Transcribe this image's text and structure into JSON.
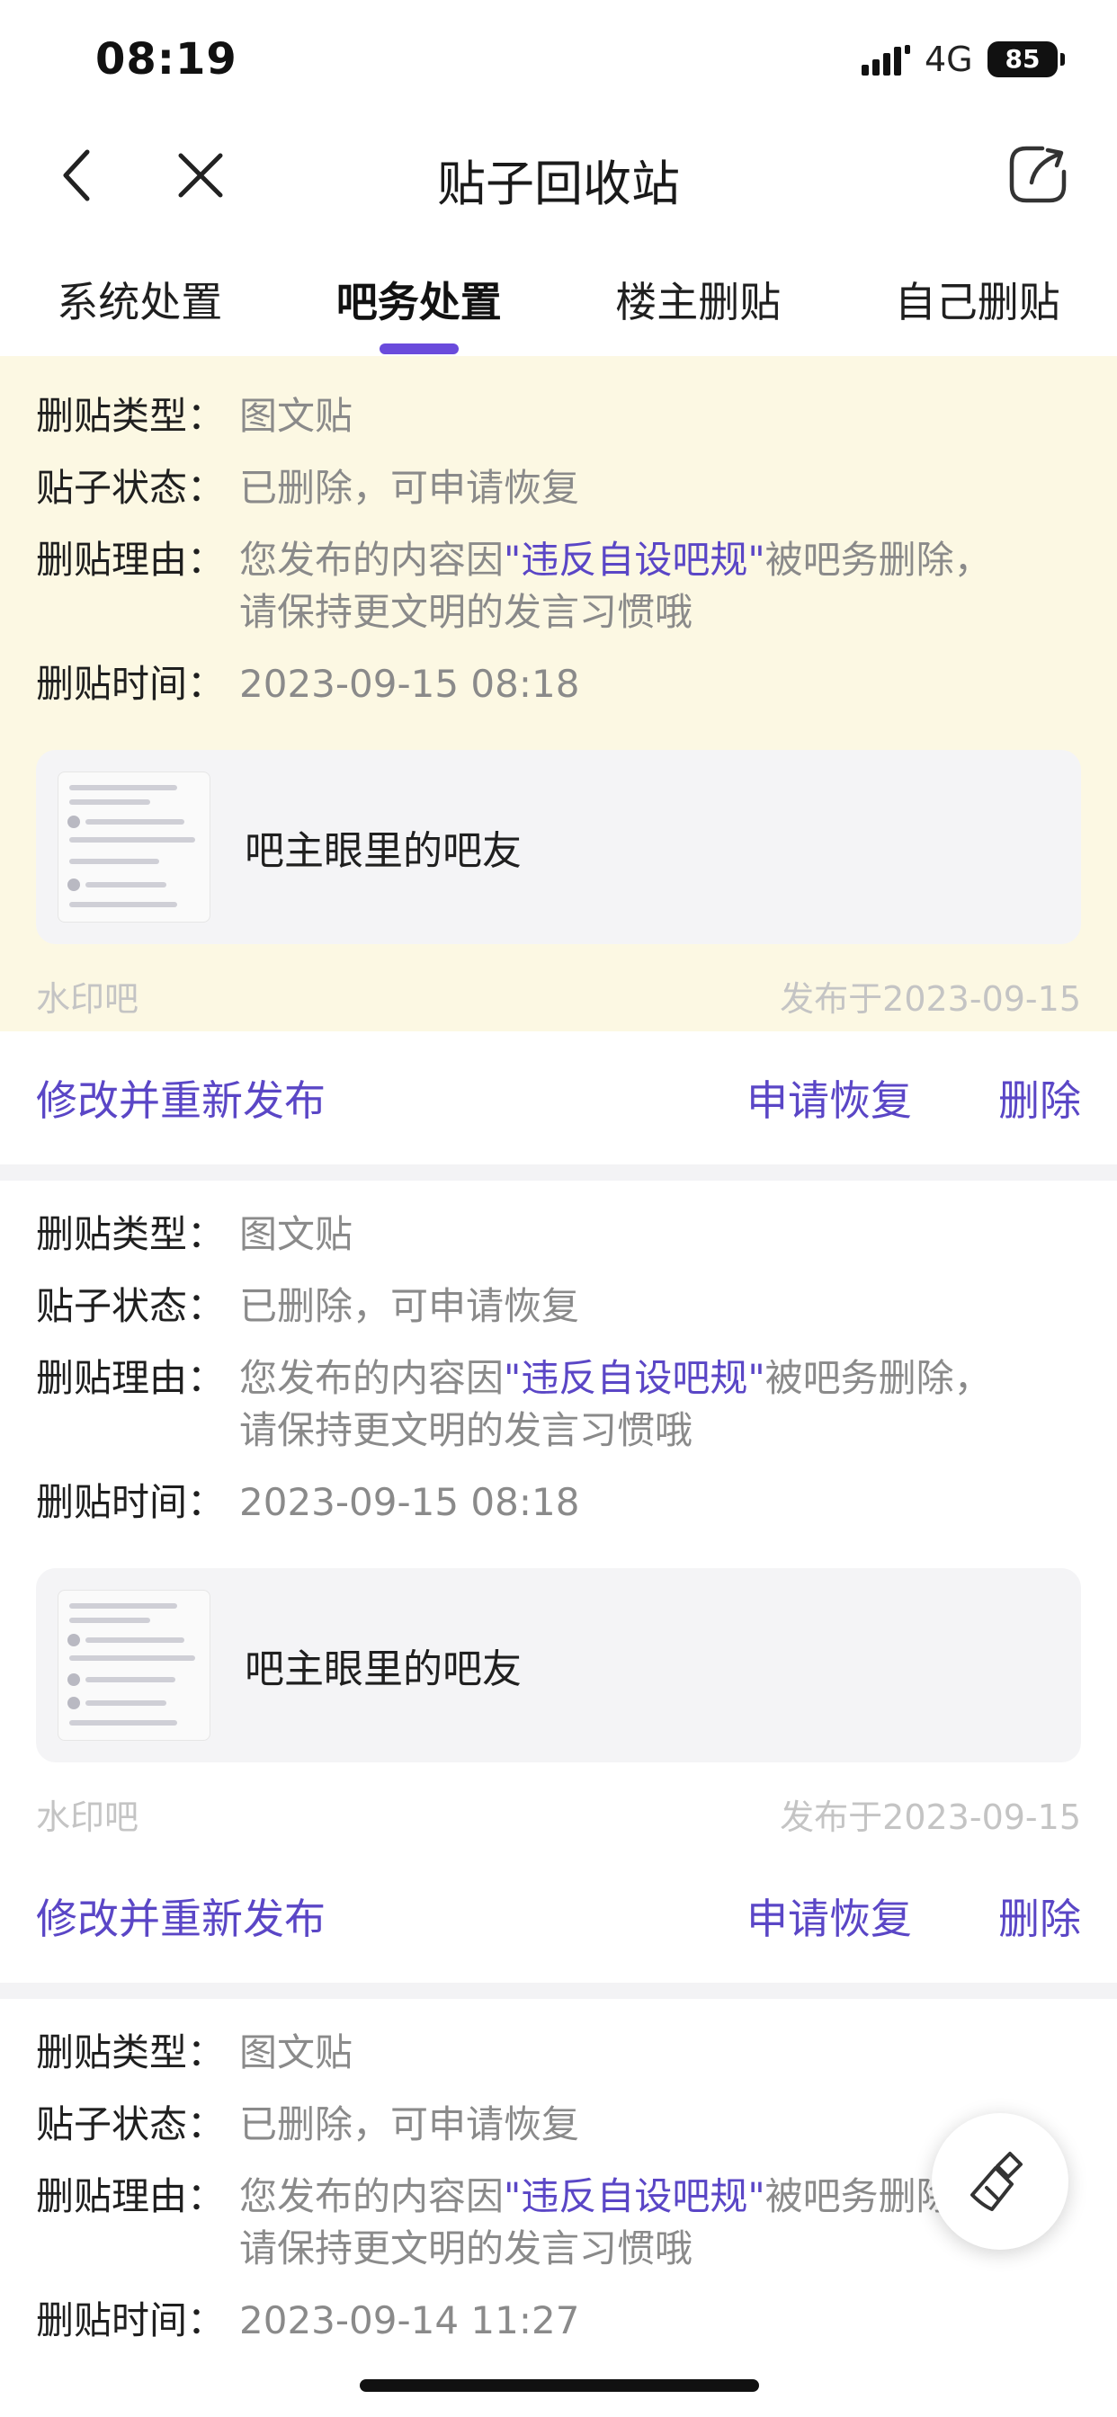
{
  "status_bar": {
    "time": "08:19",
    "network": "4G",
    "battery": "85"
  },
  "header": {
    "title": "贴子回收站"
  },
  "tabs": [
    {
      "label": "系统处置",
      "active": false
    },
    {
      "label": "吧务处置",
      "active": true
    },
    {
      "label": "楼主删贴",
      "active": false
    },
    {
      "label": "自己删贴",
      "active": false
    }
  ],
  "labels": {
    "type": "删贴类型：",
    "status": "贴子状态：",
    "reason": "删贴理由：",
    "time": "删贴时间："
  },
  "accent_color": "#5a46c6",
  "cards": [
    {
      "type": "图文贴",
      "status": "已删除，可申请恢复",
      "reason_prefix": "您发布的内容因",
      "reason_rule": "\"违反自设吧规\"",
      "reason_suffix": "被吧务删除，",
      "reason_line2": "请保持更文明的发言习惯哦",
      "time": "2023-09-15 08:18",
      "post_title": "吧主眼里的吧友",
      "forum": "水印吧",
      "published": "发布于2023-09-15",
      "actions": {
        "edit": "修改并重新发布",
        "restore": "申请恢复",
        "delete": "删除"
      }
    },
    {
      "type": "图文贴",
      "status": "已删除，可申请恢复",
      "reason_prefix": "您发布的内容因",
      "reason_rule": "\"违反自设吧规\"",
      "reason_suffix": "被吧务删除，",
      "reason_line2": "请保持更文明的发言习惯哦",
      "time": "2023-09-15 08:18",
      "post_title": "吧主眼里的吧友",
      "forum": "水印吧",
      "published": "发布于2023-09-15",
      "actions": {
        "edit": "修改并重新发布",
        "restore": "申请恢复",
        "delete": "删除"
      }
    },
    {
      "type": "图文贴",
      "status": "已删除，可申请恢复",
      "reason_prefix": "您发布的内容因",
      "reason_rule": "\"违反自设吧规\"",
      "reason_suffix": "被吧务删除，",
      "reason_line2": "请保持更文明的发言习惯哦",
      "time": "2023-09-14 11:27"
    }
  ]
}
